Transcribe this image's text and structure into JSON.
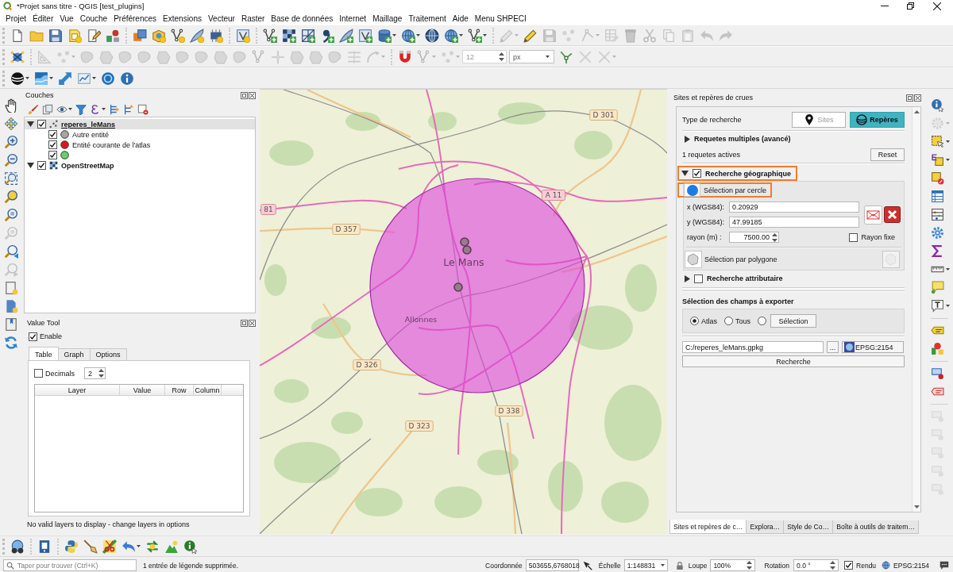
{
  "window": {
    "title": "*Projet sans titre - QGIS [test_plugins]"
  },
  "menu_bar": [
    "Projet",
    "Éditer",
    "Vue",
    "Couche",
    "Préférences",
    "Extensions",
    "Vecteur",
    "Raster",
    "Base de données",
    "Internet",
    "Maillage",
    "Traitement",
    "Aide",
    "Menu SHPECI"
  ],
  "toolbar_rows": [
    [
      {
        "disabled": false
      },
      {
        "disabled": false
      },
      {
        "disabled": false
      },
      {
        "disabled": false
      },
      {
        "disabled": false
      },
      {
        "disabled": false
      },
      {
        "disabled": false
      },
      {
        "disabled": false
      },
      {
        "disabled": false
      },
      {
        "disabled": false
      },
      {
        "disabled": false
      },
      {
        "disabled": false
      },
      {
        "disabled": false
      },
      {
        "disabled": false
      },
      {
        "disabled": false
      },
      {
        "disabled": false
      },
      {
        "disabled": false
      },
      {
        "disabled": false
      },
      {
        "disabled": false
      },
      {
        "disabled": false
      },
      {
        "disabled": false
      },
      {
        "disabled": false
      },
      {
        "disabled": false
      },
      {
        "disabled": true
      },
      {
        "disabled": false
      },
      {
        "disabled": true
      },
      {
        "disabled": true
      },
      {
        "disabled": true
      },
      {
        "disabled": true
      },
      {
        "disabled": true
      },
      {
        "disabled": true
      },
      {
        "disabled": true
      },
      {
        "disabled": true
      },
      {
        "disabled": true
      },
      {
        "disabled": true
      }
    ],
    [
      {
        "disabled": false
      },
      {
        "disabled": true
      },
      {
        "disabled": true
      },
      {
        "disabled": true
      },
      {
        "disabled": true
      },
      {
        "disabled": true
      },
      {
        "disabled": true
      },
      {
        "disabled": true
      },
      {
        "disabled": true
      },
      {
        "disabled": true
      },
      {
        "disabled": true
      },
      {
        "disabled": true
      },
      {
        "disabled": true
      },
      {
        "disabled": true
      },
      {
        "disabled": true
      },
      {
        "disabled": true
      },
      {
        "disabled": true
      },
      {
        "disabled": true
      },
      {
        "disabled": true
      },
      {
        "disabled": false
      },
      {
        "disabled": true
      },
      {
        "disabled": true
      },
      {
        "disabled": false
      },
      {
        "disabled": true
      },
      {
        "disabled": true
      }
    ],
    [
      {
        "disabled": false
      },
      {
        "disabled": false
      },
      {
        "disabled": false
      },
      {
        "disabled": false
      },
      {
        "disabled": false
      },
      {
        "disabled": false
      }
    ]
  ],
  "snapping_tolerance": {
    "value": "12",
    "disabled": true
  },
  "snapping_unit": {
    "value": "px",
    "disabled": false
  },
  "left_toolbar": [
    {
      "disabled": false
    },
    {
      "disabled": false
    },
    {
      "disabled": false
    },
    {
      "disabled": false
    },
    {
      "disabled": false
    },
    {
      "disabled": false
    },
    {
      "disabled": false
    },
    {
      "disabled": true
    },
    {
      "disabled": false
    },
    {
      "disabled": true
    },
    {
      "disabled": false
    },
    {
      "disabled": false
    },
    {
      "disabled": false
    },
    {
      "disabled": false
    }
  ],
  "layers_panel": {
    "title": "Couches",
    "tree": [
      {
        "kind": "point_layer",
        "label": "reperes_leMans",
        "checked": true,
        "expanded": true,
        "selected": true,
        "underlined": true,
        "children": [
          {
            "kind": "legend_symbol",
            "label": "Autre entité",
            "checked": true,
            "selected": false,
            "color": "#a6a6a6"
          },
          {
            "kind": "legend_symbol",
            "label": "Entité courante de l'atlas",
            "checked": true,
            "selected": false,
            "color": "#d7191c"
          },
          {
            "kind": "legend_symbol",
            "checked": true,
            "selected": false,
            "color": "#6ad06a"
          }
        ]
      },
      {
        "kind": "raster_layer",
        "label": "OpenStreetMap",
        "checked": true,
        "expanded": true,
        "selected": false,
        "underlined": false
      }
    ]
  },
  "value_tool": {
    "title": "Value Tool",
    "enable": {
      "label": "Enable",
      "checked": true
    },
    "tabs": [
      {
        "label": "Table",
        "selected": true
      },
      {
        "label": "Graph",
        "selected": false
      },
      {
        "label": "Options",
        "selected": false
      }
    ],
    "decimals": {
      "label": "Decimals",
      "checked": false,
      "value": "2"
    },
    "table": {
      "columns": [
        "Layer",
        "Value",
        "Row",
        "Column"
      ]
    },
    "message": "No valid layers to display - change layers in options"
  },
  "map": {
    "place_labels": [
      "Le Mans",
      "Allonnes"
    ],
    "road_labels": [
      {
        "kind": "departmental",
        "text": "D 301"
      },
      {
        "kind": "motorway",
        "text": "A 11"
      },
      {
        "kind": "motorway",
        "text": "81"
      },
      {
        "kind": "departmental",
        "text": "D 357"
      },
      {
        "kind": "departmental",
        "text": "D 326"
      },
      {
        "kind": "departmental",
        "text": "D 338"
      },
      {
        "kind": "departmental",
        "text": "D 323"
      }
    ]
  },
  "search_panel": {
    "title": "Sites et repères de crues",
    "search_type": {
      "label": "Type de recherche",
      "options": [
        {
          "label": "Sites",
          "selected": false
        },
        {
          "label": "Repères",
          "selected": true
        }
      ]
    },
    "multi_queries": {
      "label": "Requetes multiples (avancé)",
      "expanded": false
    },
    "active_queries": "1 requetes actives",
    "reset_button": "Reset",
    "geo_search": {
      "label": "Recherche géographique",
      "checked": true,
      "expanded": true,
      "highlighted": true,
      "circle_selection": {
        "label": "Sélection par cercle",
        "highlighted": true
      },
      "x": {
        "label": "x (WGS84):",
        "value": "0.20929"
      },
      "y": {
        "label": "y (WGS84):",
        "value": "47.99185"
      },
      "radius": {
        "label": "rayon (m) :",
        "value": "7500.00"
      },
      "fixed_radius": {
        "label": "Rayon fixe",
        "checked": false
      },
      "polygon_selection": {
        "label": "Sélection par polygone"
      }
    },
    "attribute_search": {
      "label": "Recherche attributaire",
      "checked": false,
      "expanded": false
    },
    "export_fields": {
      "title": "Sélection des champs à exporter",
      "options": [
        {
          "label": "Atlas",
          "selected": true
        },
        {
          "label": "Tous",
          "selected": false
        },
        {
          "selected": false
        }
      ],
      "selection_button": "Sélection"
    },
    "output_path": "C:/reperes_leMans.gpkg",
    "browse_button": "...",
    "crs_button": "EPSG:2154",
    "search_button": "Recherche"
  },
  "dock_tabs": [
    {
      "label": "Sites et repères de c…",
      "selected": true
    },
    {
      "label": "Explora…",
      "selected": false
    },
    {
      "label": "Style de Co…",
      "selected": false
    },
    {
      "label": "Boîte à outils de traitem…",
      "selected": false
    }
  ],
  "right_toolbar": [
    {
      "disabled": false
    },
    {
      "disabled": true
    },
    {
      "disabled": false
    },
    {
      "disabled": false
    },
    {
      "disabled": false
    },
    {
      "disabled": false
    },
    {
      "disabled": false
    },
    {
      "disabled": false
    },
    {
      "disabled": false
    },
    {
      "disabled": false
    },
    {
      "disabled": false
    },
    {
      "disabled": false
    },
    {
      "disabled": false
    },
    {
      "disabled": false
    },
    {
      "disabled": false
    },
    {
      "disabled": false
    },
    {
      "disabled": true
    },
    {
      "disabled": true
    },
    {
      "disabled": true
    },
    {
      "disabled": true
    },
    {
      "disabled": true
    }
  ],
  "bottom_toolbar": [
    {
      "disabled": false
    },
    {
      "disabled": false
    },
    {
      "disabled": false
    },
    {
      "disabled": false
    },
    {
      "disabled": false
    },
    {
      "disabled": false
    },
    {
      "disabled": false
    },
    {
      "disabled": false
    },
    {
      "disabled": false
    }
  ],
  "status_bar": {
    "search": {
      "placeholder": "Taper pour trouver (Ctrl+K)"
    },
    "message": "1 entrée de légende supprimée.",
    "coordinate": {
      "label": "Coordonnée",
      "value": "503655,6768018"
    },
    "scale": {
      "label": "Échelle",
      "value": "1:148831"
    },
    "magnifier": {
      "label": "Loupe",
      "value": "100%"
    },
    "rotation": {
      "label": "Rotation",
      "value": "0.0 °"
    },
    "render": {
      "label": "Rendu",
      "checked": true
    },
    "crs": "EPSG:2154"
  }
}
